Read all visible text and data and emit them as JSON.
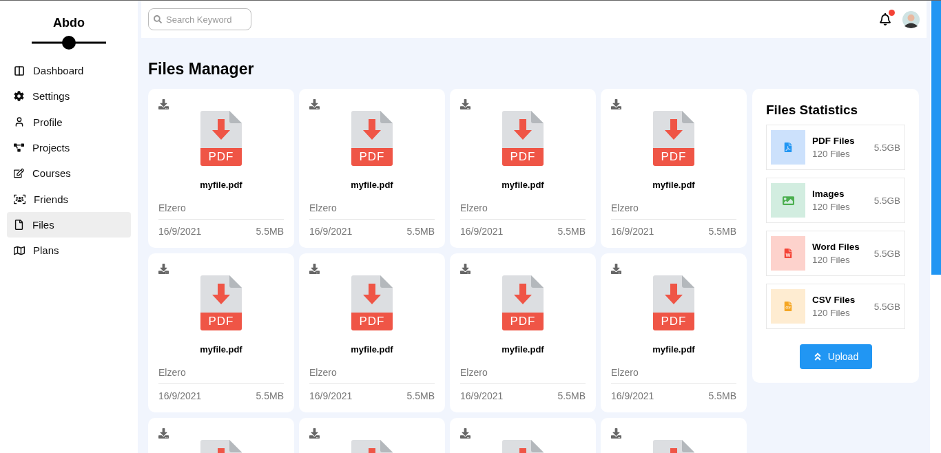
{
  "sidebar": {
    "brand": "Abdo",
    "items": [
      {
        "kind": "dashboard",
        "label": "Dashboard",
        "selected": false
      },
      {
        "kind": "settings",
        "label": "Settings",
        "selected": false
      },
      {
        "kind": "profile",
        "label": "Profile",
        "selected": false
      },
      {
        "kind": "projects",
        "label": "Projects",
        "selected": false
      },
      {
        "kind": "courses",
        "label": "Courses",
        "selected": false
      },
      {
        "kind": "friends",
        "label": "Friends",
        "selected": false
      },
      {
        "kind": "files",
        "label": "Files",
        "selected": true
      },
      {
        "kind": "plans",
        "label": "Plans",
        "selected": false
      }
    ]
  },
  "header": {
    "search": {
      "placeholder": "Search Keyword"
    },
    "notification_unread": true
  },
  "page_title": "Files Manager",
  "files": [
    {
      "kind": "full",
      "type_label": "PDF",
      "name": "myfile.pdf",
      "owner": "Elzero",
      "date": "16/9/2021",
      "size": "5.5MB"
    },
    {
      "kind": "full",
      "type_label": "PDF",
      "name": "myfile.pdf",
      "owner": "Elzero",
      "date": "16/9/2021",
      "size": "5.5MB"
    },
    {
      "kind": "full",
      "type_label": "PDF",
      "name": "myfile.pdf",
      "owner": "Elzero",
      "date": "16/9/2021",
      "size": "5.5MB"
    },
    {
      "kind": "full",
      "type_label": "PDF",
      "name": "myfile.pdf",
      "owner": "Elzero",
      "date": "16/9/2021",
      "size": "5.5MB"
    },
    {
      "kind": "full",
      "type_label": "PDF",
      "name": "myfile.pdf",
      "owner": "Elzero",
      "date": "16/9/2021",
      "size": "5.5MB"
    },
    {
      "kind": "full",
      "type_label": "PDF",
      "name": "myfile.pdf",
      "owner": "Elzero",
      "date": "16/9/2021",
      "size": "5.5MB"
    },
    {
      "kind": "full",
      "type_label": "PDF",
      "name": "myfile.pdf",
      "owner": "Elzero",
      "date": "16/9/2021",
      "size": "5.5MB"
    },
    {
      "kind": "full",
      "type_label": "PDF",
      "name": "myfile.pdf",
      "owner": "Elzero",
      "date": "16/9/2021",
      "size": "5.5MB"
    },
    {
      "kind": "cut"
    },
    {
      "kind": "cut"
    },
    {
      "kind": "cut"
    },
    {
      "kind": "cut"
    }
  ],
  "statistics": {
    "title": "Files Statistics",
    "items": [
      {
        "kind": "pdf",
        "color": "#cce1fc",
        "name": "PDF Files",
        "count": "120 Files",
        "size": "5.5GB"
      },
      {
        "kind": "image",
        "color": "#d2ede0",
        "name": "Images",
        "count": "120 Files",
        "size": "5.5GB"
      },
      {
        "kind": "word",
        "color": "#fdd2cc",
        "name": "Word Files",
        "count": "120 Files",
        "size": "5.5GB"
      },
      {
        "kind": "csv",
        "color": "#feecd1",
        "name": "CSV Files",
        "count": "120 Files",
        "size": "5.5GB"
      }
    ],
    "upload_button": "Upload"
  }
}
